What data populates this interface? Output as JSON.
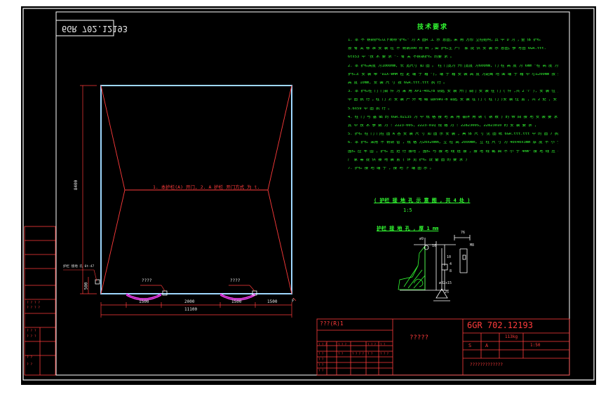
{
  "colors": {
    "paper": "#000000",
    "border": "#ffffff",
    "frame": "#ff3b3b",
    "notes": "#33ff33",
    "text": "#e8e8e8",
    "rail": "#ff44ff"
  },
  "drawing_number": "6GR 702.12193",
  "mirror_number": "6GR 702.12193",
  "notes": {
    "title": "技术要求",
    "items": [
      "1. 本 不 锈钢护栏以下简称\"护栏\" 为 A 图R 工 示 意图，采 用 方形 立柱结构，其 中 D 为 ，整 体 护栏",
      "   按 有 关 标 准 安 装 在 不 锈钢300 材 料 ，由 护栏生 产厂 家 提 供 安 装 示 意图。参 考图 6GR.ttt.",
      "   6ts53 中 \"技 术 要 求 \"- 有 关 不锈钢护栏 的要 求 。",
      "2. 本 护栏高度 为1000mm, 长 宽尺寸 如 图 。 柱 门宽为 开门宽度 为600mm, 门 柱 高 度 为 6mm \"柱 高 度 为 M0,",
      "   护栏上 安 装 带 \"DZX-WHM 检 定 端 子 箱 \"), 端 子 箱 安 装 高 度 为距离 地 面 端 子 箱 中 心1200mm 按 要 求",
      "   高 度 10mm, 安 装 尺 寸 按 6GR.ttt.ttt 执 行 。",
      "3. 本 护栏柱 门 门锁 件 为 采 用 XP1-40L/B 钥匙 安 装 开门 锁门 安 装 在 门 ( 件 ,共 2 个 ), 安 装 位 置 按 6GR.ttt.ttt",
      "   中 图 执 行 ，柱 门 上 安 装 户 外 电 磁 锁DSWI-B 钥匙 安 装 在 门 ( 柱 门 )安 装 位 置 , 共 2 处 , 安 装 位 置 按 6GR.tt",
      "   5.6s59 中 图 执 行 。",
      "4. 柱 门 与 基 础 的 6GR.02135 为 中 规 格 接 地 采 用 镀锌 角 钢 ( 钢 板 ) 的 带 回 接 地 安 装 要 求 , 本 护栏 要",
      "   其 中 技 术 参 数 为 : 2223-00S, 2223-01Q 规 格 为 : 2282300S, 22823010 的 安 装 要 求 ,",
      "5. 护栏 柱 门 门柱 图 A 各 安 装 尺 寸 如 图 示 安 装 , 具 体 尺 寸 见 图 纸 6GR.ttt.ttt 中 的 图 7 执 行 。",
      "6. 本 护栏 采用 不 锈钢 管 , 规 格 为20x20mm, 立 柱 高 2000mm, 立 柱 尺 寸 为 40x40x3mm 厚 度 不 小 于 1mm,",
      "   围栏 应 牢 固 , 护栏 应 进 行 接地 , 围栏 与 接 地 线 连 接 , 接 地 线 截 面 不 小 于 4mm² 接 地 线 应 与 接 地 网 相 连 , 接 地 线,",
      "   厂 家 需 提 供 接 地 装 置 ( 详 见 护栏 设 备 图 的 要 求 )",
      "7. 护栏 接 地 端 子 , 接 地 下 端 图 示 。"
    ]
  },
  "section": {
    "title": "( 护栏 接 地 孔 示 意 图 , 共 4 处 )",
    "scale": "1:5",
    "subtitle": "护栏 接 地 孔 , 厚 1 mm",
    "dims": [
      "76",
      "M8",
      "10",
      "ø9",
      "10",
      "4",
      "8",
      "ø25",
      "ø32x15",
      "25"
    ]
  },
  "plan": {
    "center_label": "1. 本护栏(A) 开门, 2. A 护栏 开门方式 为 t.",
    "overall_width": "11100",
    "segments": [
      "1500",
      "2000",
      "1500"
    ],
    "height": "8400",
    "bottom_dim": "500",
    "left_dim": "1500",
    "gate_labels": [
      "????",
      "????"
    ],
    "left_callout": "护栏 接地 孔 6t-47",
    "mark_f": "F"
  },
  "title_block": {
    "left_text": "???(R)1",
    "center_text": "?????",
    "weight": "113kg",
    "scale": "1:50",
    "grade_s": "S",
    "grade_a": "A",
    "bottom_text": "?????????????",
    "header_cells": [
      "? ? ?",
      "? ? ?",
      "? ? ?",
      "? ?"
    ],
    "row_marks": [
      "? ?",
      "? ?",
      "? ?",
      "? ?",
      "? ?"
    ],
    "sign_cells": [
      "? ?",
      "? ? ? ?",
      "? ?",
      "? ? ?"
    ]
  },
  "left_strip": {
    "marks": [
      "? ? ? ?",
      "? ? ? ?",
      "? ? ?",
      "? ? ?",
      "? ?",
      "? ?"
    ]
  }
}
